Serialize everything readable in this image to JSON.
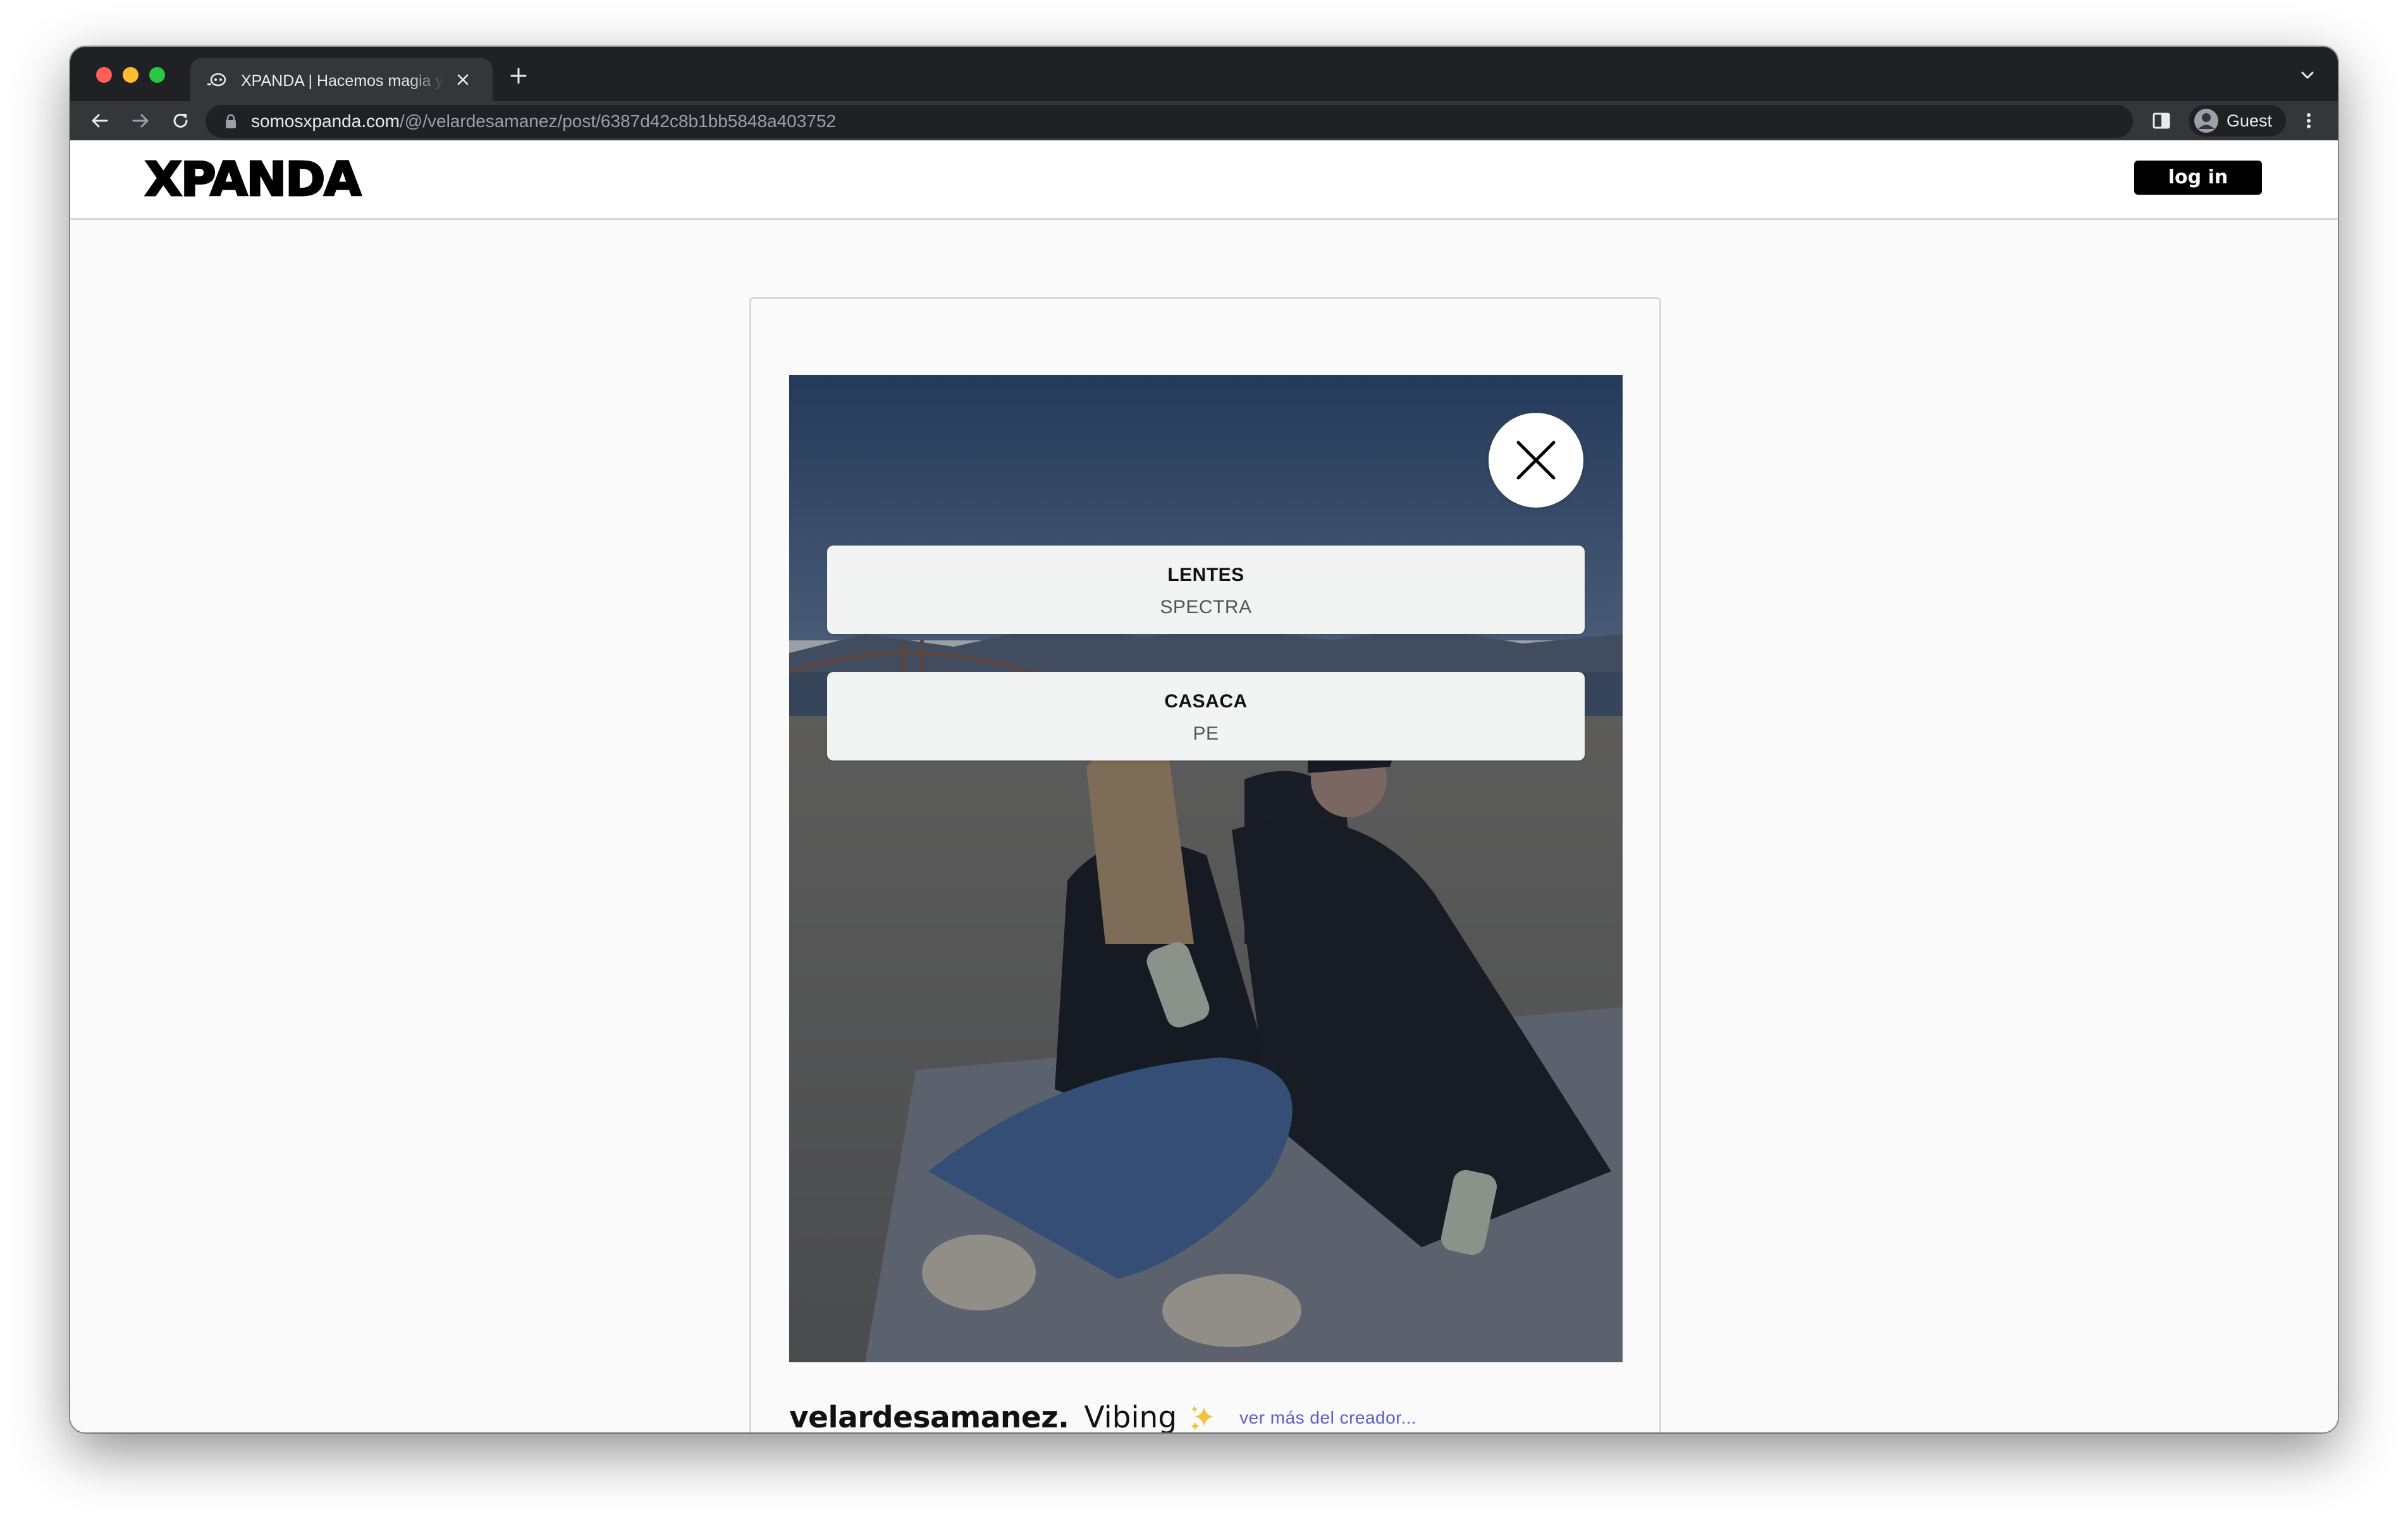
{
  "browser": {
    "tab_title": "XPANDA | Hacemos magia y te",
    "url_host": "somosxpanda.com",
    "url_path": "/@/velardesamanez/post/6387d42c8b1bb5848a403752",
    "profile_label": "Guest",
    "icons": [
      "back-icon",
      "forward-icon",
      "reload-icon",
      "lock-icon",
      "side-panel-icon",
      "avatar-icon",
      "kebab-menu-icon",
      "new-tab-icon",
      "tab-close-icon",
      "chevron-down-icon"
    ]
  },
  "site": {
    "logo": "XPANDA",
    "login_label": "log in"
  },
  "post": {
    "products": [
      {
        "name": "LENTES",
        "brand": "SPECTRA"
      },
      {
        "name": "CASACA",
        "brand": "PE"
      }
    ],
    "username": "velardesamanez.",
    "caption": "Vibing",
    "caption_emoji": "sparkles-icon",
    "more_link": "ver más del creador..."
  }
}
